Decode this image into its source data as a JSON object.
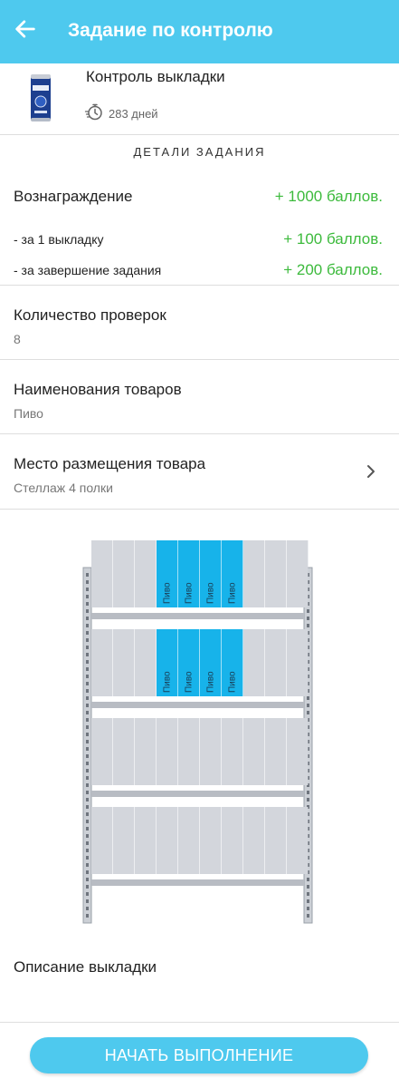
{
  "header": {
    "title": "Задание по контролю",
    "back_icon": "arrow-left-icon"
  },
  "product": {
    "name": "Контроль выкладки",
    "duration": "283 дней",
    "timer_icon": "stopwatch-icon",
    "image_label": "BALTIKA"
  },
  "details": {
    "section_title": "ДЕТАЛИ ЗАДАНИЯ",
    "reward_label": "Вознаграждение",
    "reward_value": "+ 1000 баллов.",
    "per_display_label": "- за 1 выкладку",
    "per_display_value": "+ 100 баллов.",
    "completion_label": "- за завершение задания",
    "completion_value": "+ 200 баллов.",
    "checks_label": "Количество проверок",
    "checks_value": "8",
    "products_label": "Наименования товаров",
    "products_value": "Пиво",
    "location_label": "Место размещения товара",
    "location_value": "Стеллаж 4 полки"
  },
  "planogram": {
    "shelves": 4,
    "slots_per_shelf": 10,
    "highlighted_shelves": [
      1,
      2
    ],
    "highlighted_slots": [
      4,
      5,
      6,
      7
    ],
    "slot_label": "Пиво",
    "highlight_color": "#17b3ea",
    "empty_color": "#d3d6dc"
  },
  "description": {
    "label": "Описание выкладки"
  },
  "actions": {
    "start_label": "НАЧАТЬ ВЫПОЛНЕНИЕ"
  },
  "colors": {
    "accent": "#4ec9ee",
    "reward": "#3cba3c"
  }
}
